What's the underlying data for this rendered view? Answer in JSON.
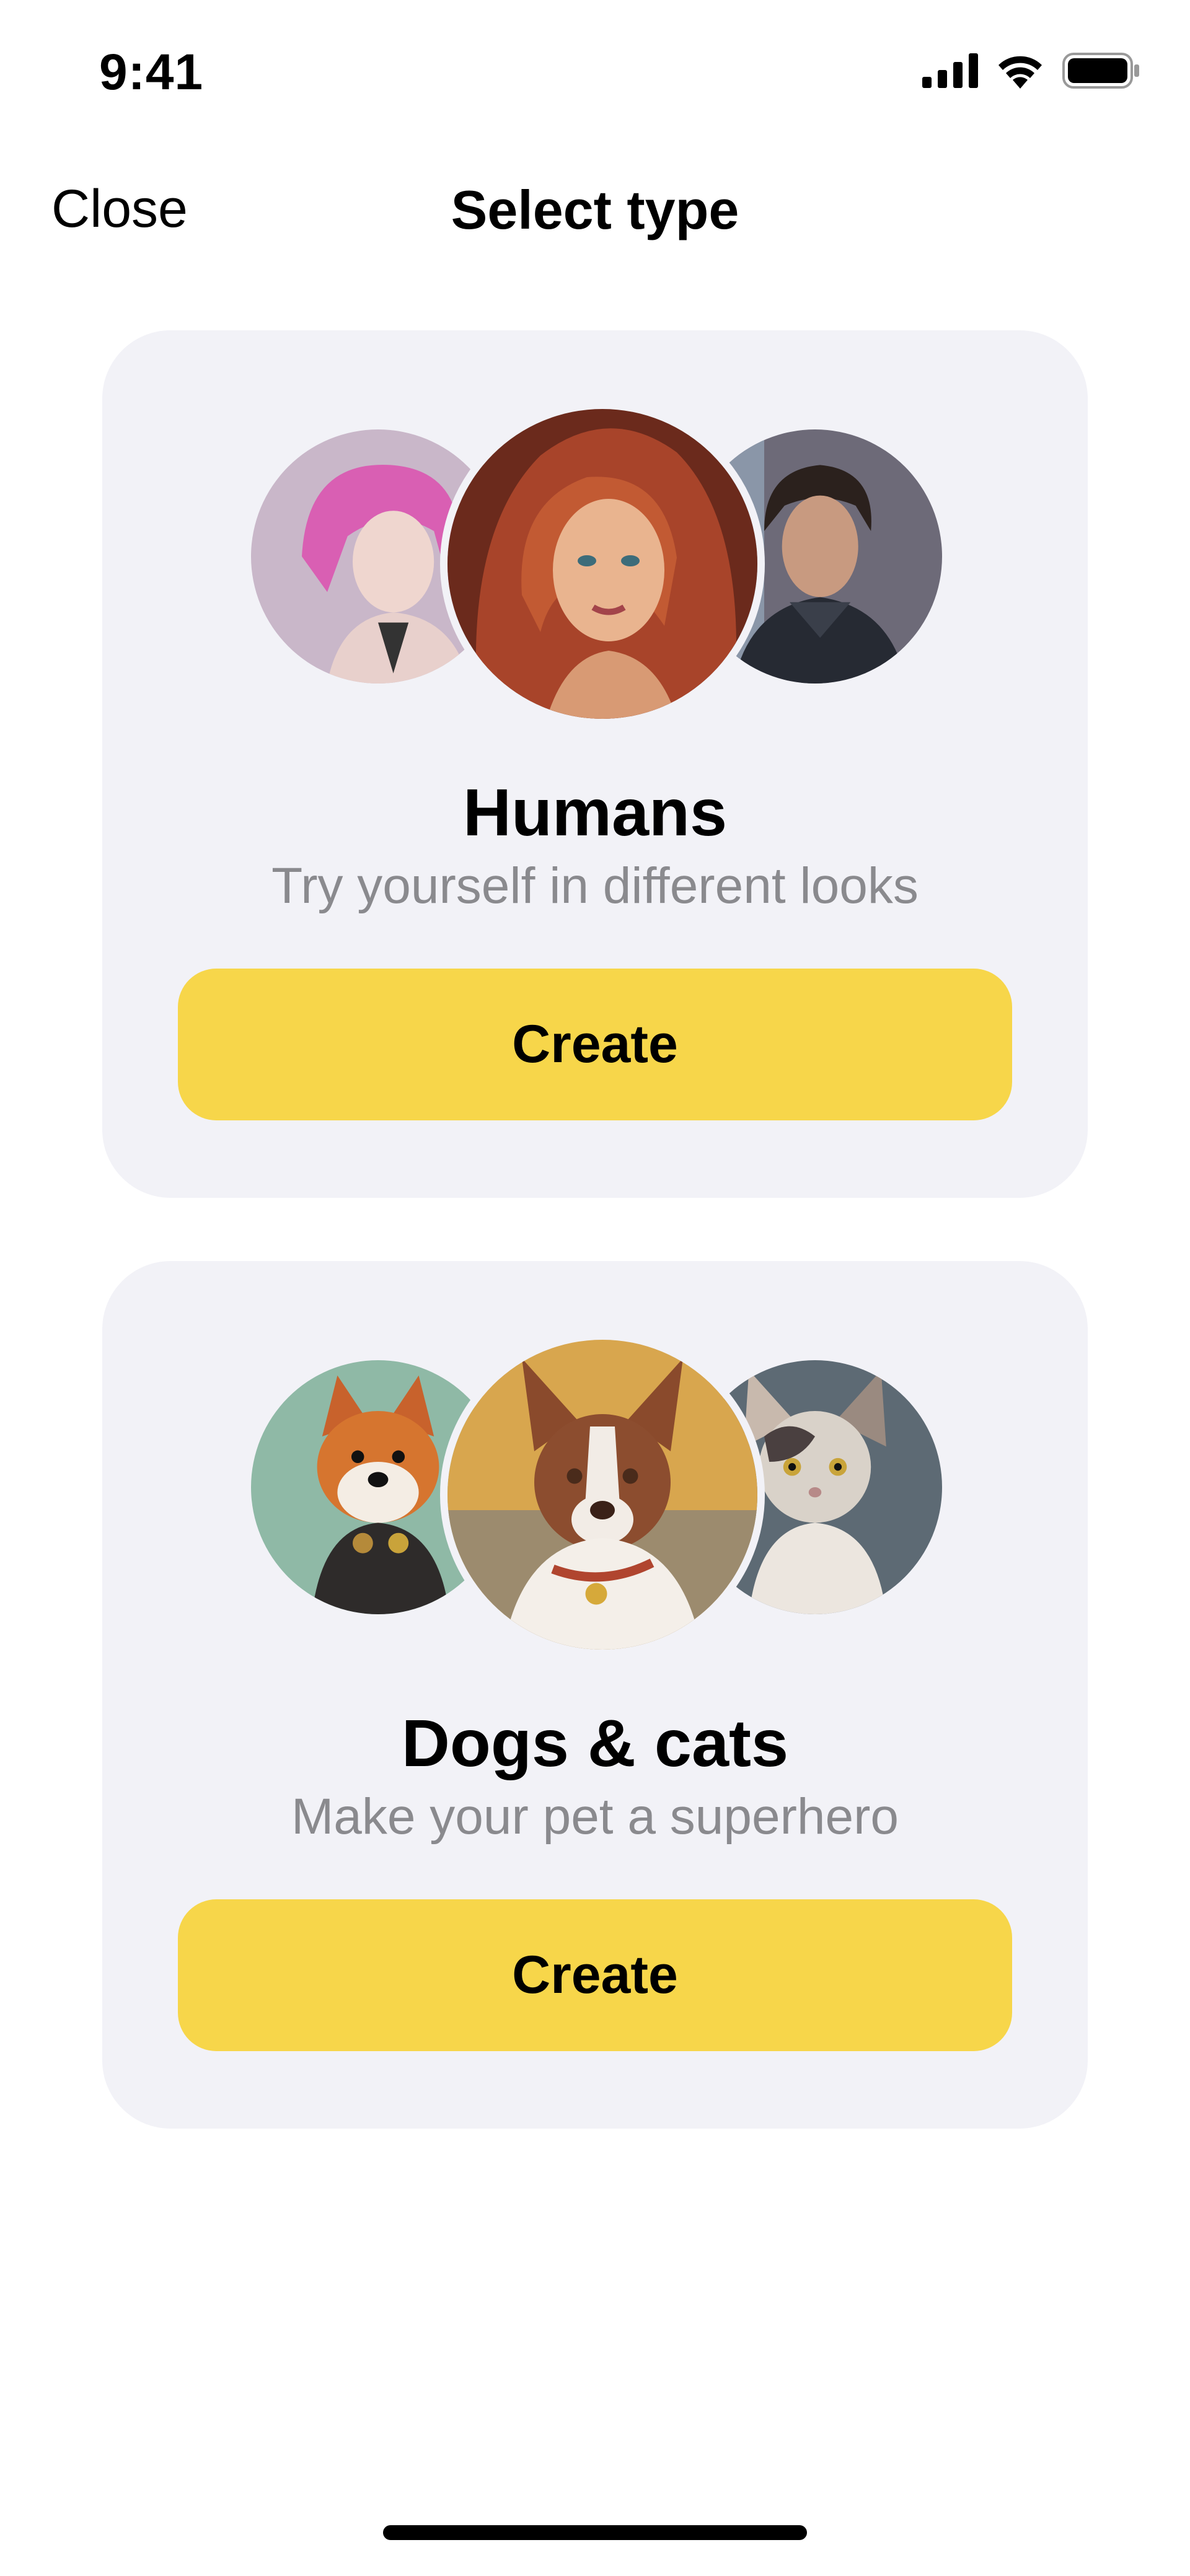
{
  "status_bar": {
    "time": "9:41",
    "icons": [
      "signal-icon",
      "wifi-icon",
      "battery-icon"
    ]
  },
  "nav": {
    "close_label": "Close",
    "title": "Select type"
  },
  "cards": [
    {
      "title": "Humans",
      "subtitle": "Try yourself in different looks",
      "button_label": "Create",
      "avatars": [
        "pink-haired-woman-avatar",
        "red-haired-woman-avatar",
        "man-avatar"
      ]
    },
    {
      "title": "Dogs & cats",
      "subtitle": "Make your pet a superhero",
      "button_label": "Create",
      "avatars": [
        "shiba-dog-avatar",
        "collie-dog-avatar",
        "cat-avatar"
      ]
    }
  ],
  "colors": {
    "card_background": "#f2f2f7",
    "button_accent": "#f7d64a",
    "subtitle_gray": "#8a8a8e"
  }
}
